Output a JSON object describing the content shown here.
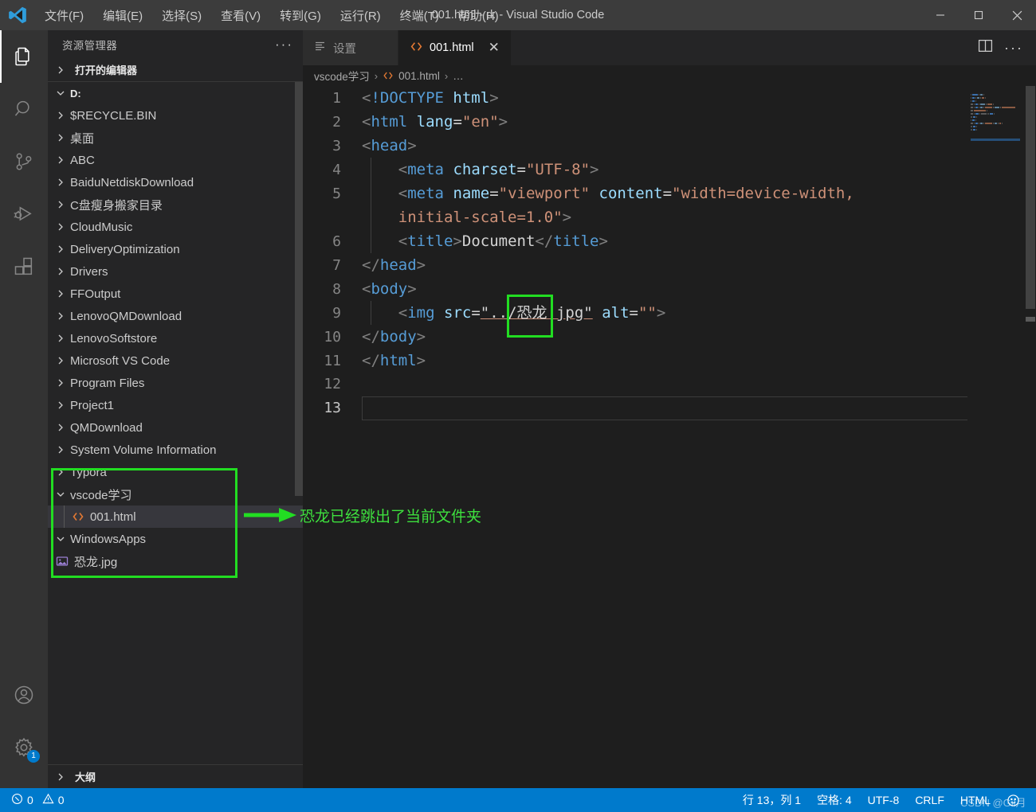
{
  "window": {
    "title": "001.html - d: - Visual Studio Code",
    "minimize": "─",
    "maximize": "□",
    "close": "✕"
  },
  "menu": {
    "items": [
      {
        "label": "文件(F)"
      },
      {
        "label": "编辑(E)"
      },
      {
        "label": "选择(S)"
      },
      {
        "label": "查看(V)"
      },
      {
        "label": "转到(G)"
      },
      {
        "label": "运行(R)"
      },
      {
        "label": "终端(T)"
      },
      {
        "label": "帮助(H)"
      }
    ]
  },
  "activitybar": {
    "items": [
      {
        "name": "explorer",
        "icon": "files-icon",
        "active": true
      },
      {
        "name": "search",
        "icon": "search-icon",
        "active": false
      },
      {
        "name": "source-control",
        "icon": "source-control-icon",
        "active": false
      },
      {
        "name": "run-and-debug",
        "icon": "run-debug-icon",
        "active": false
      },
      {
        "name": "extensions",
        "icon": "extensions-icon",
        "active": false
      }
    ],
    "account_icon": "account-icon",
    "settings_icon": "gear-icon",
    "settings_badge": "1"
  },
  "sidebar": {
    "title": "资源管理器",
    "more_actions": "···",
    "open_editors_label": "打开的编辑器",
    "outline_label": "大纲",
    "root_label": "D:",
    "tree": [
      {
        "label": "$RECYCLE.BIN",
        "type": "folder",
        "expanded": false,
        "depth": 1
      },
      {
        "label": "桌面",
        "type": "folder",
        "expanded": false,
        "depth": 1
      },
      {
        "label": "ABC",
        "type": "folder",
        "expanded": false,
        "depth": 1
      },
      {
        "label": "BaiduNetdiskDownload",
        "type": "folder",
        "expanded": false,
        "depth": 1
      },
      {
        "label": "C盘瘦身搬家目录",
        "type": "folder",
        "expanded": false,
        "depth": 1
      },
      {
        "label": "CloudMusic",
        "type": "folder",
        "expanded": false,
        "depth": 1
      },
      {
        "label": "DeliveryOptimization",
        "type": "folder",
        "expanded": false,
        "depth": 1
      },
      {
        "label": "Drivers",
        "type": "folder",
        "expanded": false,
        "depth": 1
      },
      {
        "label": "FFOutput",
        "type": "folder",
        "expanded": false,
        "depth": 1
      },
      {
        "label": "LenovoQMDownload",
        "type": "folder",
        "expanded": false,
        "depth": 1
      },
      {
        "label": "LenovoSoftstore",
        "type": "folder",
        "expanded": false,
        "depth": 1
      },
      {
        "label": "Microsoft VS Code",
        "type": "folder",
        "expanded": false,
        "depth": 1
      },
      {
        "label": "Program Files",
        "type": "folder",
        "expanded": false,
        "depth": 1
      },
      {
        "label": "Project1",
        "type": "folder",
        "expanded": false,
        "depth": 1
      },
      {
        "label": "QMDownload",
        "type": "folder",
        "expanded": false,
        "depth": 1
      },
      {
        "label": "System Volume Information",
        "type": "folder",
        "expanded": false,
        "depth": 1
      },
      {
        "label": "Typora",
        "type": "folder",
        "expanded": false,
        "depth": 1
      },
      {
        "label": "vscode学习",
        "type": "folder",
        "expanded": true,
        "depth": 1
      },
      {
        "label": "001.html",
        "type": "html-file",
        "expanded": false,
        "depth": 2,
        "selected": true
      },
      {
        "label": "WindowsApps",
        "type": "folder",
        "expanded": true,
        "depth": 1
      },
      {
        "label": "恐龙.jpg",
        "type": "image-file",
        "expanded": false,
        "depth": 1
      }
    ]
  },
  "editor": {
    "tabs": [
      {
        "label": "设置",
        "icon": "settings-tab-icon",
        "active": false
      },
      {
        "label": "001.html",
        "icon": "html-icon",
        "active": true,
        "close": "✕"
      }
    ],
    "actions": {
      "split_editor": "split-editor-icon",
      "more": "···"
    },
    "breadcrumb": [
      {
        "label": "vscode学习",
        "icon": ""
      },
      {
        "label": "001.html",
        "icon": "html-icon"
      },
      {
        "label": "…",
        "icon": ""
      }
    ],
    "breadcrumb_sep": "›",
    "lines": [
      {
        "num": "1",
        "tokens": [
          {
            "t": "brk",
            "v": "<"
          },
          {
            "t": "tagb",
            "v": "!DOCTYPE"
          },
          {
            "t": "txt",
            "v": " "
          },
          {
            "t": "attr",
            "v": "html"
          },
          {
            "t": "brk",
            "v": ">"
          }
        ]
      },
      {
        "num": "2",
        "tokens": [
          {
            "t": "brk",
            "v": "<"
          },
          {
            "t": "tagb",
            "v": "html"
          },
          {
            "t": "txt",
            "v": " "
          },
          {
            "t": "attr",
            "v": "lang"
          },
          {
            "t": "eq",
            "v": "="
          },
          {
            "t": "str",
            "v": "\"en\""
          },
          {
            "t": "brk",
            "v": ">"
          }
        ]
      },
      {
        "num": "3",
        "tokens": [
          {
            "t": "brk",
            "v": "<"
          },
          {
            "t": "tagb",
            "v": "head"
          },
          {
            "t": "brk",
            "v": ">"
          }
        ]
      },
      {
        "num": "4",
        "tokens": [
          {
            "t": "txt",
            "v": "    "
          },
          {
            "t": "brk",
            "v": "<"
          },
          {
            "t": "tagb",
            "v": "meta"
          },
          {
            "t": "txt",
            "v": " "
          },
          {
            "t": "attr",
            "v": "charset"
          },
          {
            "t": "eq",
            "v": "="
          },
          {
            "t": "str",
            "v": "\"UTF-8\""
          },
          {
            "t": "brk",
            "v": ">"
          }
        ],
        "guide": true
      },
      {
        "num": "5",
        "tokens": [
          {
            "t": "txt",
            "v": "    "
          },
          {
            "t": "brk",
            "v": "<"
          },
          {
            "t": "tagb",
            "v": "meta"
          },
          {
            "t": "txt",
            "v": " "
          },
          {
            "t": "attr",
            "v": "name"
          },
          {
            "t": "eq",
            "v": "="
          },
          {
            "t": "str",
            "v": "\"viewport\""
          },
          {
            "t": "txt",
            "v": " "
          },
          {
            "t": "attr",
            "v": "content"
          },
          {
            "t": "eq",
            "v": "="
          },
          {
            "t": "str",
            "v": "\"width=device-width,"
          }
        ],
        "guide": true
      },
      {
        "num": "",
        "tokens": [
          {
            "t": "txt",
            "v": "    "
          },
          {
            "t": "str",
            "v": "initial-scale=1.0\""
          },
          {
            "t": "brk",
            "v": ">"
          }
        ],
        "guide": true,
        "wrapped": true
      },
      {
        "num": "6",
        "tokens": [
          {
            "t": "txt",
            "v": "    "
          },
          {
            "t": "brk",
            "v": "<"
          },
          {
            "t": "tagb",
            "v": "title"
          },
          {
            "t": "brk",
            "v": ">"
          },
          {
            "t": "txt",
            "v": "Document"
          },
          {
            "t": "brk",
            "v": "</"
          },
          {
            "t": "tagb",
            "v": "title"
          },
          {
            "t": "brk",
            "v": ">"
          }
        ],
        "guide": true
      },
      {
        "num": "7",
        "tokens": [
          {
            "t": "brk",
            "v": "</"
          },
          {
            "t": "tagb",
            "v": "head"
          },
          {
            "t": "brk",
            "v": ">"
          }
        ]
      },
      {
        "num": "8",
        "tokens": [
          {
            "t": "brk",
            "v": "<"
          },
          {
            "t": "tagb",
            "v": "body"
          },
          {
            "t": "brk",
            "v": ">"
          }
        ]
      },
      {
        "num": "9",
        "tokens": [
          {
            "t": "txt",
            "v": "    "
          },
          {
            "t": "brk",
            "v": "<"
          },
          {
            "t": "tagb",
            "v": "img"
          },
          {
            "t": "txt",
            "v": " "
          },
          {
            "t": "attr",
            "v": "src"
          },
          {
            "t": "eq",
            "v": "="
          },
          {
            "t": "str-underline",
            "v": "\"../恐龙.jpg\""
          },
          {
            "t": "txt",
            "v": " "
          },
          {
            "t": "attr",
            "v": "alt"
          },
          {
            "t": "eq",
            "v": "="
          },
          {
            "t": "str",
            "v": "\"\""
          },
          {
            "t": "brk",
            "v": ">"
          }
        ],
        "guide": true
      },
      {
        "num": "10",
        "tokens": [
          {
            "t": "brk",
            "v": "</"
          },
          {
            "t": "tagb",
            "v": "body"
          },
          {
            "t": "brk",
            "v": ">"
          }
        ]
      },
      {
        "num": "11",
        "tokens": [
          {
            "t": "brk",
            "v": "</"
          },
          {
            "t": "tagb",
            "v": "html"
          },
          {
            "t": "brk",
            "v": ">"
          }
        ]
      },
      {
        "num": "12",
        "tokens": []
      },
      {
        "num": "13",
        "tokens": [],
        "cursor": true
      }
    ]
  },
  "statusbar": {
    "errors_icon": "error-icon",
    "errors": "0",
    "warnings_icon": "warning-icon",
    "warnings": "0",
    "cursor_position": "行 13，列 1",
    "indentation": "空格: 4",
    "encoding": "UTF-8",
    "eol": "CRLF",
    "language": "HTML",
    "feedback_icon": "smiley-icon"
  },
  "annotations": {
    "code_box_label": "",
    "tree_box_label": "",
    "arrow_note": "恐龙已经跳出了当前文件夹",
    "accent_green": "#22dd22",
    "watermark": "CSDN @Gil月"
  }
}
